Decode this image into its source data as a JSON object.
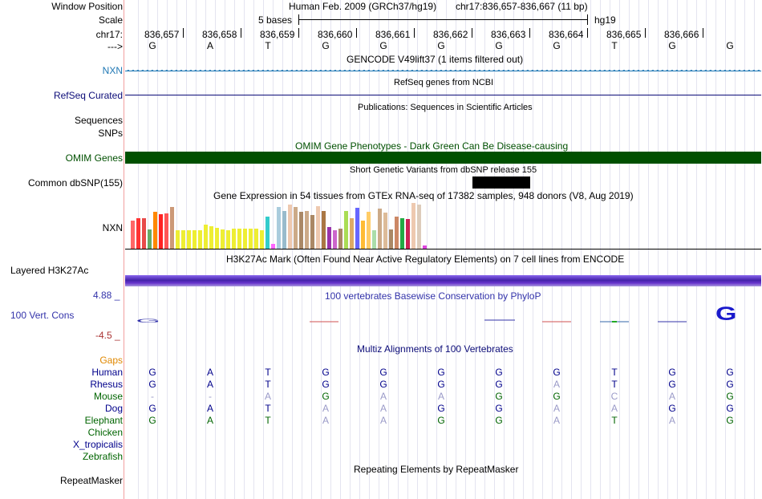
{
  "header": {
    "window_position_label": "Window Position",
    "scale_label": "Scale",
    "chrom_label": "chr17:",
    "arrow_label": "--->",
    "assembly": "Human Feb. 2009 (GRCh37/hg19)",
    "position": "chr17:836,657-836,667 (11 bp)",
    "scale_text": "5 bases",
    "scale_db": "hg19",
    "ticks": [
      "836,657",
      "836,658",
      "836,659",
      "836,660",
      "836,661",
      "836,662",
      "836,663",
      "836,664",
      "836,665",
      "836,666"
    ],
    "bases": [
      "G",
      "A",
      "T",
      "G",
      "G",
      "G",
      "G",
      "G",
      "T",
      "G",
      "G"
    ]
  },
  "tracks": {
    "gencode": {
      "title": "GENCODE V49lift37 (1 items filtered out)",
      "label": "NXN",
      "color": "#1f77b4"
    },
    "refseq": {
      "title": "RefSeq genes from NCBI",
      "label": "RefSeq Curated",
      "color": "#0c0c78"
    },
    "pubs": {
      "title": "Publications: Sequences in Scientific Articles",
      "label1": "Sequences",
      "label2": "SNPs"
    },
    "omim": {
      "title": "OMIM Gene Phenotypes - Dark Green Can Be Disease-causing",
      "label": "OMIM Genes",
      "color": "#005000"
    },
    "dbsnp": {
      "title": "Short Genetic Variants from dbSNP release 155",
      "label": "Common dbSNP(155)"
    },
    "gtex": {
      "title": "Gene Expression in 54 tissues from GTEx RNA-seq of 17382 samples, 948 donors (V8, Aug 2019)",
      "label": "NXN",
      "bar_colors": [
        "#ff6666",
        "#ff3333",
        "#e84a4a",
        "#66aa66",
        "#ff8800",
        "#ff2222",
        "#ff5555",
        "#cc9977",
        "#eeee33",
        "#eeee33",
        "#eeee33",
        "#eeee33",
        "#eeee33",
        "#eeee33",
        "#eeee33",
        "#eeee33",
        "#eeee33",
        "#eeee33",
        "#eeee33",
        "#eeee33",
        "#eeee33",
        "#eeee33",
        "#eeee33",
        "#eeee33",
        "#33cccc",
        "#ff66ff",
        "#aaccdd",
        "#99bbcc",
        "#eec9b0",
        "#ccaa88",
        "#aa8866",
        "#ccaa88",
        "#aa8866",
        "#eec9b0",
        "#aa7744",
        "#9933aa",
        "#cc66cc",
        "#aa8866",
        "#aadd55",
        "#ddaa66",
        "#6666ff",
        "#ffbb33",
        "#ffcc66",
        "#aaddaa",
        "#ccaa88",
        "#ddbb99",
        "#aa8866",
        "#cc8866",
        "#22aa44",
        "#cc2255",
        "#eec9b0",
        "#ddccbb",
        "#dd44dd"
      ],
      "bar_values": [
        0.35,
        0.38,
        0.38,
        0.24,
        0.46,
        0.43,
        0.44,
        0.52,
        0.23,
        0.23,
        0.23,
        0.23,
        0.23,
        0.3,
        0.28,
        0.26,
        0.24,
        0.23,
        0.25,
        0.25,
        0.25,
        0.25,
        0.25,
        0.23,
        0.4,
        0.06,
        0.52,
        0.47,
        0.55,
        0.52,
        0.46,
        0.47,
        0.42,
        0.53,
        0.47,
        0.27,
        0.23,
        0.25,
        0.47,
        0.38,
        0.51,
        0.35,
        0.46,
        0.23,
        0.5,
        0.45,
        0.24,
        0.4,
        0.38,
        0.37,
        0.57,
        0.55,
        0.04
      ]
    },
    "h3k27ac": {
      "title": "H3K27Ac Mark (Often Found Near Active Regulatory Elements) on 7 cell lines from ENCODE",
      "label": "Layered H3K27Ac",
      "color": "#6633cc"
    },
    "phylop": {
      "title": "100 vertebrates Basewise Conservation by PhyloP",
      "label": "100 Vert. Cons",
      "max": "4.88 _",
      "min": "-4.5 _",
      "color": "#3333aa"
    },
    "multiz": {
      "title": "Multiz Alignments of 100 Vertebrates",
      "gaps_label": "Gaps"
    },
    "repeatmasker": {
      "title": "Repeating Elements by RepeatMasker",
      "label": "RepeatMasker"
    }
  },
  "alignment": [
    {
      "species": "Human",
      "color": "#00008b",
      "bases": [
        "G",
        "A",
        "T",
        "G",
        "G",
        "G",
        "G",
        "G",
        "T",
        "G",
        "G"
      ],
      "faded": [
        0,
        0,
        0,
        0,
        0,
        0,
        0,
        0,
        0,
        0,
        0
      ]
    },
    {
      "species": "Rhesus",
      "color": "#00008b",
      "bases": [
        "G",
        "A",
        "T",
        "G",
        "G",
        "G",
        "G",
        "A",
        "T",
        "G",
        "G"
      ],
      "faded": [
        0,
        0,
        0,
        0,
        0,
        0,
        0,
        1,
        0,
        0,
        0
      ]
    },
    {
      "species": "Mouse",
      "color": "#006400",
      "bases": [
        "-",
        "-",
        "A",
        "G",
        "A",
        "A",
        "G",
        "G",
        "C",
        "A",
        "G"
      ],
      "faded": [
        1,
        1,
        1,
        0,
        1,
        1,
        0,
        0,
        1,
        1,
        0
      ]
    },
    {
      "species": "Dog",
      "color": "#00008b",
      "bases": [
        "G",
        "A",
        "T",
        "A",
        "A",
        "G",
        "G",
        "A",
        "A",
        "G",
        "G"
      ],
      "faded": [
        0,
        0,
        0,
        1,
        1,
        0,
        0,
        1,
        1,
        0,
        0
      ]
    },
    {
      "species": "Elephant",
      "color": "#006400",
      "bases": [
        "G",
        "A",
        "T",
        "A",
        "A",
        "G",
        "G",
        "A",
        "T",
        "A",
        "G"
      ],
      "faded": [
        0,
        0,
        0,
        1,
        1,
        0,
        0,
        1,
        0,
        1,
        0
      ]
    },
    {
      "species": "Chicken",
      "color": "#006400",
      "bases": [],
      "faded": []
    },
    {
      "species": "X_tropicalis",
      "color": "#00008b",
      "bases": [],
      "faded": []
    },
    {
      "species": "Zebrafish",
      "color": "#006400",
      "bases": [],
      "faded": []
    }
  ]
}
